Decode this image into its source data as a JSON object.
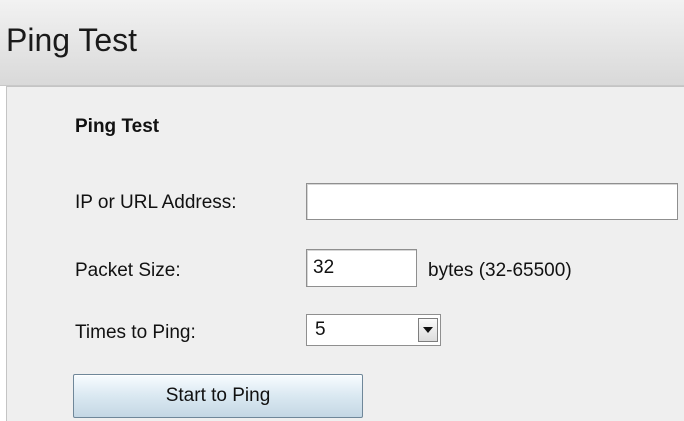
{
  "page": {
    "title": "Ping Test"
  },
  "form": {
    "section_title": "Ping Test",
    "address": {
      "label": "IP or URL Address:",
      "value": ""
    },
    "packet_size": {
      "label": "Packet Size:",
      "value": "32",
      "unit_hint": "bytes (32-65500)"
    },
    "times_to_ping": {
      "label": "Times to Ping:",
      "selected": "5"
    },
    "start_button_label": "Start to Ping"
  },
  "icons": {
    "dropdown": "chevron-down-icon"
  },
  "colors": {
    "panel_background": "#efefef",
    "header_background": "#dedede",
    "button_top": "#f8fcff",
    "button_bottom": "#c4d7e4"
  }
}
